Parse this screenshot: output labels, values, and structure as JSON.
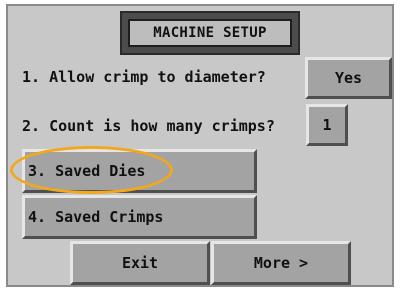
{
  "screen": {
    "title": "MACHINE SETUP",
    "questions": [
      {
        "label": "1. Allow crimp to diameter?",
        "value": "Yes"
      },
      {
        "label": "2. Count is how many crimps?",
        "value": "1"
      }
    ],
    "menu": {
      "saved_dies": "3. Saved Dies",
      "saved_crimps": "4. Saved Crimps"
    },
    "footer": {
      "exit": "Exit",
      "more": "More >"
    }
  },
  "colors": {
    "panel": "#c8c8c8",
    "button": "#a3a3a3",
    "highlight_annotation": "#f2a81d"
  }
}
